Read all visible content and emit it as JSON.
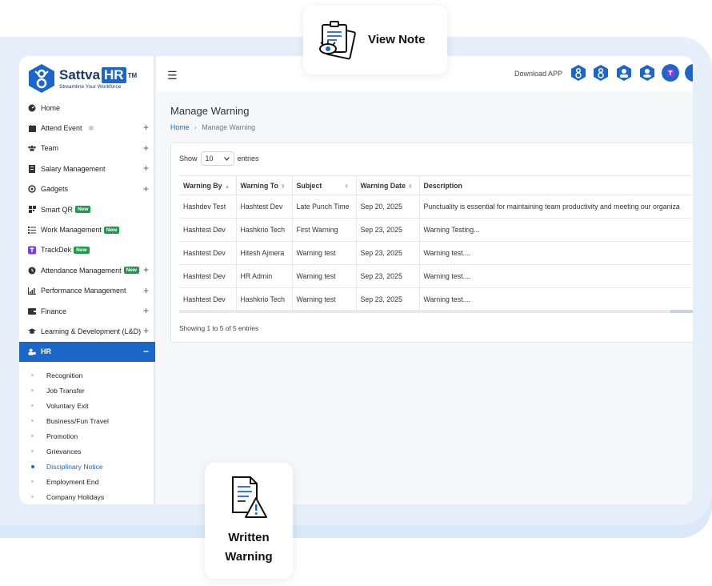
{
  "brand": {
    "title": "Sattva",
    "title_hr": "HR",
    "tm": "TM",
    "tagline": "Streamline Your Workforce"
  },
  "topbar": {
    "download_label": "Download APP"
  },
  "sidebar": {
    "items": [
      {
        "label": "Home",
        "icon": "dashboard-icon",
        "plus": false
      },
      {
        "label": "Attend Event",
        "icon": "calendar-icon",
        "plus": true
      },
      {
        "label": "Team",
        "icon": "team-icon",
        "plus": true
      },
      {
        "label": "Salary Management",
        "icon": "salary-icon",
        "plus": true
      },
      {
        "label": "Gadgets",
        "icon": "gadget-icon",
        "plus": true
      },
      {
        "label": "Smart QR",
        "icon": "qr-icon",
        "plus": false,
        "badge": "New"
      },
      {
        "label": "Work Management",
        "icon": "list-icon",
        "plus": false,
        "badge": "New"
      },
      {
        "label": "TrackDek",
        "icon": "trackdek-icon",
        "plus": false,
        "badge": "New"
      },
      {
        "label": "Attendance Management",
        "icon": "clock-icon",
        "plus": true,
        "badge": "New"
      },
      {
        "label": "Performance Management",
        "icon": "chart-icon",
        "plus": true
      },
      {
        "label": "Finance",
        "icon": "wallet-icon",
        "plus": true
      },
      {
        "label": "Learning & Development (L&D)",
        "icon": "graduation-icon",
        "plus": true
      },
      {
        "label": "HR",
        "icon": "hr-icon",
        "minus": "−"
      }
    ],
    "plus_symbol": "+",
    "sub_items": [
      "Recognition",
      "Job Transfer",
      "Voluntary Exit",
      "Business/Fun Travel",
      "Promotion",
      "Grievances",
      "Disciplinary Notice",
      "Employment End",
      "Company Holidays"
    ]
  },
  "main": {
    "title": "Manage Warning",
    "breadcrumb": {
      "home": "Home",
      "sep": "›",
      "current": "Manage Warning"
    },
    "show": {
      "prefix": "Show",
      "value": "10",
      "suffix": "entries"
    },
    "table": {
      "headers": [
        "Warning By",
        "Warning To",
        "Subject",
        "Warning Date",
        "Description"
      ],
      "rows": [
        [
          "Hashdev Test",
          "Hashtest Dev",
          "Late Punch Time",
          "Sep 20, 2025",
          "Punctuality is essential for maintaining team productivity and meeting our organiza"
        ],
        [
          "Hashtest Dev",
          "Hashkrio Tech",
          "First Warning",
          "Sep 23, 2025",
          "Warning Testing..."
        ],
        [
          "Hashtest Dev",
          "Hitesh Ajmera",
          "Warning test",
          "Sep 23, 2025",
          "Warning test...."
        ],
        [
          "Hashtest Dev",
          "HR Admin",
          "Warning test",
          "Sep 23, 2025",
          "Warning test...."
        ],
        [
          "Hashtest Dev",
          "Hashkrio Tech",
          "Warning test",
          "Sep 23, 2025",
          "Warning test...."
        ]
      ]
    },
    "showing": "Showing 1 to 5 of 5 entries"
  },
  "cards": {
    "view_note": "View Note",
    "written_warning_1": "Written",
    "written_warning_2": "Warning"
  },
  "colors": {
    "accent": "#1b66c9",
    "badge": "#1d9a4a",
    "bg_band": "#dbe8f7"
  }
}
